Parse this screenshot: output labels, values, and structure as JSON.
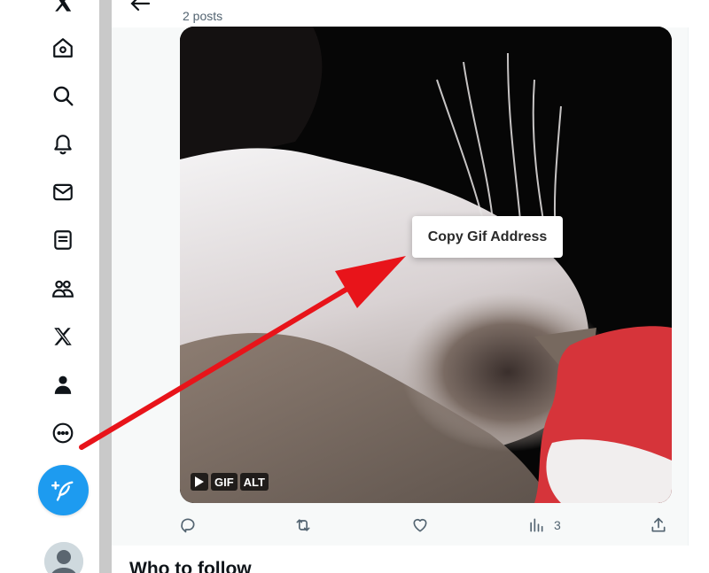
{
  "nav": {
    "items": [
      {
        "name": "x-logo-icon"
      },
      {
        "name": "home-icon"
      },
      {
        "name": "search-icon"
      },
      {
        "name": "notifications-icon"
      },
      {
        "name": "messages-icon"
      },
      {
        "name": "lists-icon"
      },
      {
        "name": "communities-icon"
      },
      {
        "name": "premium-x-icon"
      },
      {
        "name": "profile-icon"
      },
      {
        "name": "more-icon"
      }
    ],
    "compose_icon": "compose-post-icon",
    "accent_color": "#1d9bf0"
  },
  "header": {
    "post_count": "2 posts"
  },
  "media": {
    "badges": {
      "gif": "GIF",
      "alt": "ALT"
    }
  },
  "context_menu": {
    "item": "Copy Gif Address"
  },
  "actions": {
    "views": "3"
  },
  "sections": {
    "who_to_follow": "Who to follow"
  },
  "annotation": {
    "arrow_color": "#e8141a"
  }
}
